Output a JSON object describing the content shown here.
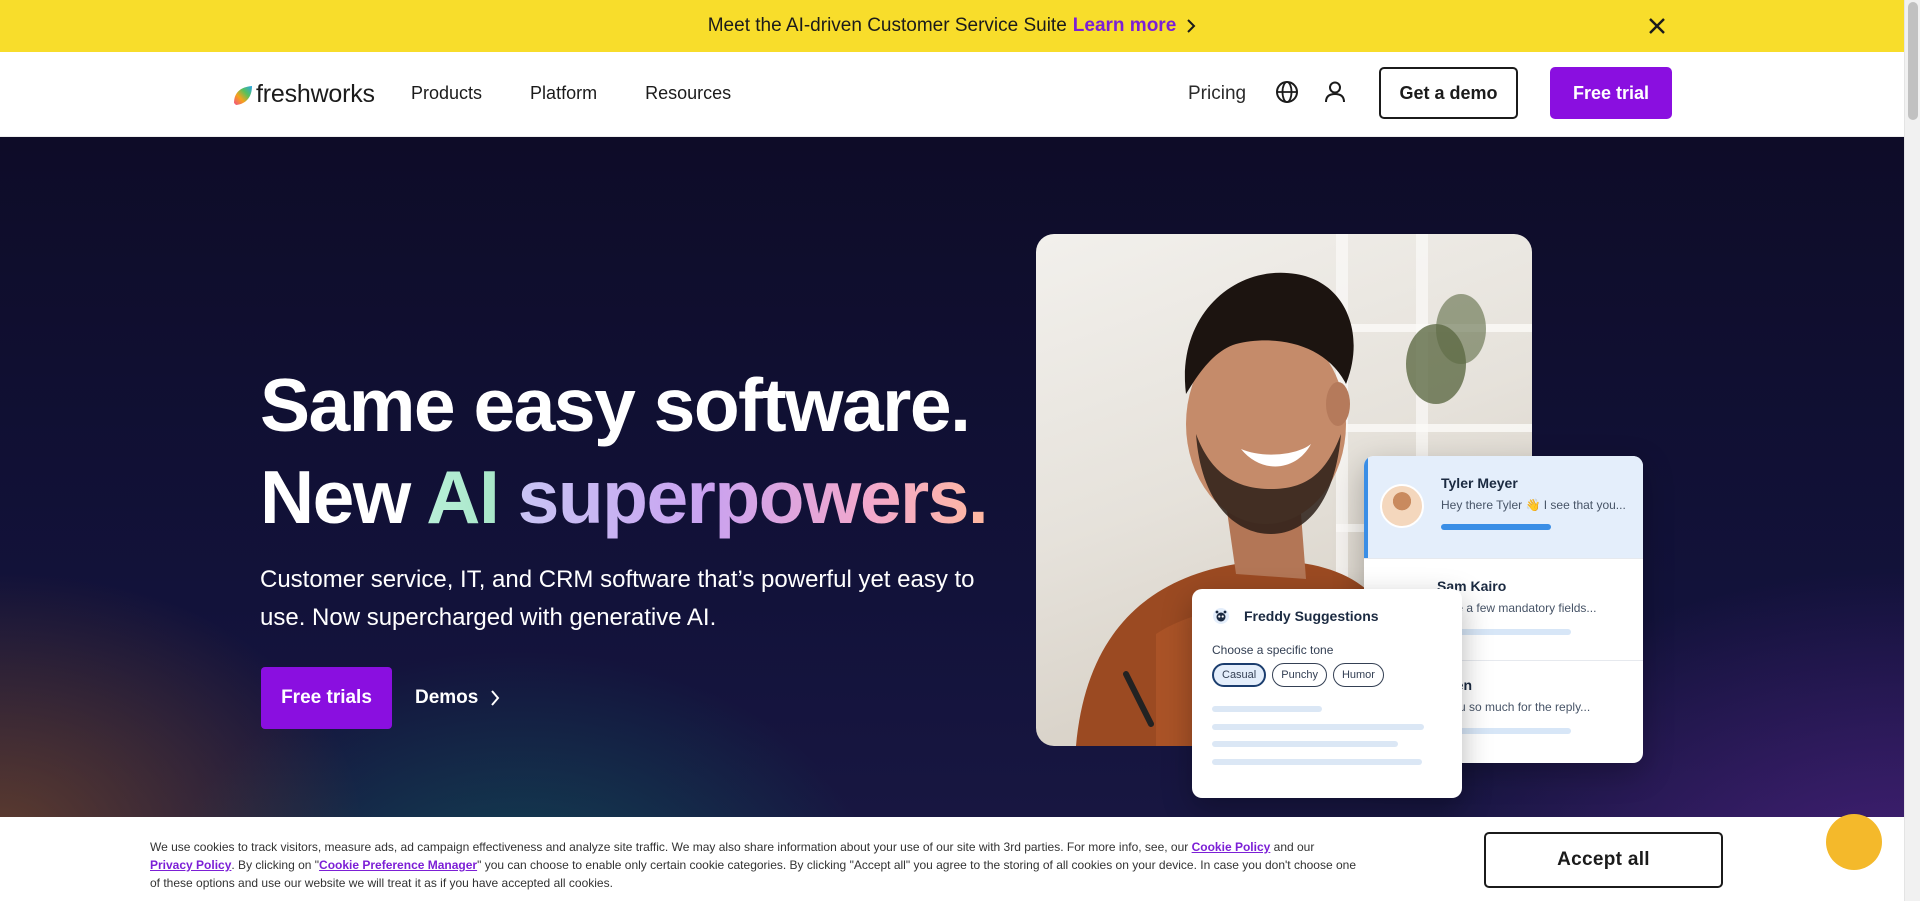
{
  "announcement": {
    "message": "Meet the AI-driven Customer Service Suite",
    "link": "Learn more"
  },
  "nav": {
    "logo_text": "freshworks",
    "links": [
      "Products",
      "Platform",
      "Resources"
    ],
    "pricing": "Pricing",
    "get_demo": "Get a demo",
    "free_trial": "Free trial"
  },
  "hero": {
    "headline_line1": "Same easy software.",
    "headline_new": "New",
    "headline_ai": "AI",
    "headline_super": "superpowers.",
    "subtitle": "Customer service, IT, and CRM software that’s powerful yet easy to use. Now supercharged with generative AI.",
    "cta_primary": "Free trials",
    "cta_secondary": "Demos"
  },
  "chat_list": [
    {
      "name": "Tyler Meyer",
      "preview": "Hey there Tyler 👋 I see that you..."
    },
    {
      "name": "Sam Kairo",
      "preview": "have a few mandatory fields..."
    },
    {
      "name": "Chen",
      "preview": "k you so much for the reply..."
    }
  ],
  "freddy": {
    "title": "Freddy Suggestions",
    "tone_label": "Choose a specific tone",
    "chips": [
      "Casual",
      "Punchy",
      "Humor"
    ],
    "selected_chip": "Casual"
  },
  "cookie": {
    "text_1": "We use cookies to track visitors, measure ads, ad campaign effectiveness and analyze site traffic. We may also share information about your use of our site with 3rd parties. For more info, see, our ",
    "cookie_policy": "Cookie Policy",
    "text_2": " and our ",
    "privacy_policy": "Privacy Policy",
    "text_3": ". By clicking on \"",
    "preference_manager": "Cookie Preference Manager",
    "text_4": "\" you can choose to enable only certain cookie categories. By clicking \"Accept all\" you agree to the storing of all cookies on your device. In case you don't choose one of these options and use our website we will treat it as if you have accepted all cookies.",
    "accept": "Accept all"
  },
  "colors": {
    "announcement_bg": "#f8dd2b",
    "brand_purple": "#8a0fe0",
    "link_purple": "#7c1fd6",
    "hero_bg": "#12123a"
  }
}
